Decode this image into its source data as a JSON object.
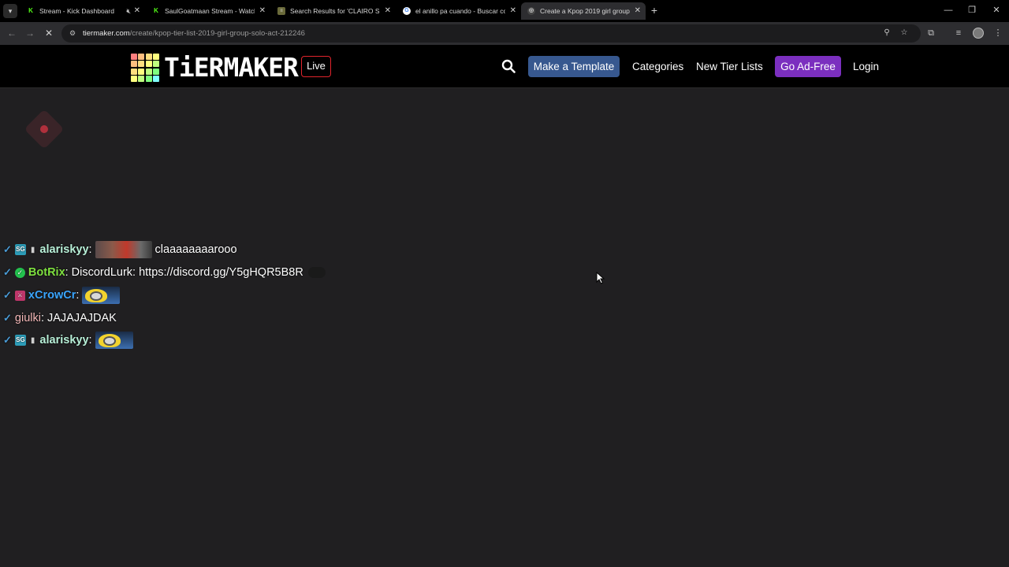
{
  "browser": {
    "tabs": [
      {
        "title": "Stream - Kick Dashboard",
        "favicon": "kick-icon",
        "muted": true,
        "active": false
      },
      {
        "title": "SaulGoatmaan Stream - Watch",
        "favicon": "kick-icon",
        "muted": false,
        "active": false
      },
      {
        "title": "Search Results for 'CLAIRO SO...",
        "favicon": "document-icon",
        "muted": false,
        "active": false
      },
      {
        "title": "el anillo pa cuando - Buscar co...",
        "favicon": "google-icon",
        "muted": false,
        "active": false
      },
      {
        "title": "Create a Kpop 2019 girl group/...",
        "favicon": "tiermaker-icon",
        "muted": false,
        "active": true
      }
    ],
    "url_host": "tiermaker.com",
    "url_path": "/create/kpop-tier-list-2019-girl-group-solo-act-212246"
  },
  "header": {
    "logo_text": "TiERMAKER",
    "live_label": "Live",
    "nav": {
      "make_template": "Make a Template",
      "categories": "Categories",
      "new_tier_lists": "New Tier Lists",
      "go_ad_free": "Go Ad-Free",
      "login": "Login"
    }
  },
  "colors": {
    "background": "#201f21",
    "header_bg": "#000000",
    "template_btn": "#37588f",
    "adfree_btn": "#7b2fbf",
    "live_border": "#e0242c"
  },
  "chat": {
    "messages": [
      {
        "username": "alariskyy",
        "username_color": "#b8f0d8",
        "text": "claaaaaaaarooo"
      },
      {
        "username": "BotRix",
        "username_color": "#7ee03f",
        "text": "DiscordLurk: https://discord.gg/Y5gHQR5B8R"
      },
      {
        "username": "xCrowCr",
        "username_color": "#3aa5ff",
        "text": ""
      },
      {
        "username": "giulki",
        "username_color": "#f5b8b8",
        "text": "JAJAJAJDAK"
      },
      {
        "username": "alariskyy",
        "username_color": "#b8f0d8",
        "text": ""
      }
    ]
  }
}
